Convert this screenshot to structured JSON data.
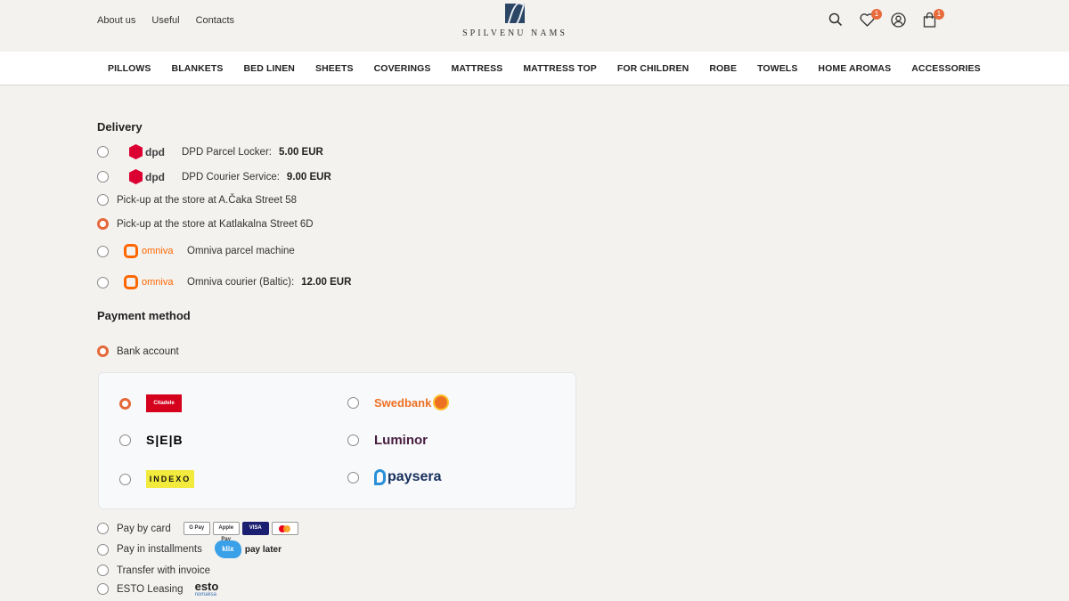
{
  "header": {
    "links": [
      "About us",
      "Useful",
      "Contacts"
    ],
    "brand": "SPILVENU NAMS",
    "wishlist_count": "1",
    "cart_count": "1"
  },
  "nav": [
    "PILLOWS",
    "BLANKETS",
    "BED LINEN",
    "SHEETS",
    "COVERINGS",
    "MATTRESS",
    "MATTRESS TOP",
    "FOR CHILDREN",
    "ROBE",
    "TOWELS",
    "HOME AROMAS",
    "ACCESSORIES"
  ],
  "delivery": {
    "title": "Delivery",
    "dpd_word": "dpd",
    "omniva_word": "omniva",
    "options": [
      {
        "label": "DPD Parcel Locker:",
        "price": "5.00  EUR"
      },
      {
        "label": "DPD Courier Service:",
        "price": "9.00  EUR"
      },
      {
        "label": "Pick-up at the store at A.Čaka Street 58"
      },
      {
        "label": "Pick-up at the store at Katlakalna Street 6D"
      },
      {
        "label": "Omniva parcel machine"
      },
      {
        "label": "Omniva courier (Baltic):",
        "price": "12.00  EUR"
      }
    ],
    "selected_index": 3
  },
  "payment": {
    "title": "Payment method",
    "bank_account": "Bank account",
    "banks": {
      "citadele": "Citadele",
      "swedbank": "Swedbank",
      "seb": "S|E|B",
      "luminor": "Luminor",
      "indexo": "INDEXO",
      "paysera": "paysera"
    },
    "selected_bank": "citadele",
    "card": "Pay by card",
    "card_icons": [
      "G Pay",
      "Apple Pay",
      "VISA",
      ""
    ],
    "installments": "Pay in installments",
    "klix": "klix",
    "klix_later": "pay later",
    "invoice": "Transfer with invoice",
    "esto": "ESTO Leasing",
    "esto_logo": "esto",
    "esto_sub": "nomaksa"
  },
  "colors": {
    "accent": "#e5683a",
    "background": "#f4f2ef"
  }
}
